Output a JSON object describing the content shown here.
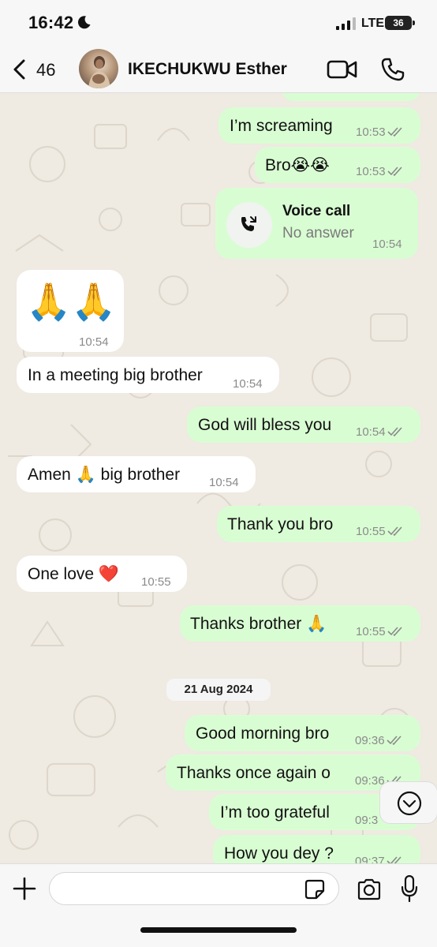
{
  "status_bar": {
    "time": "16:42",
    "network": "LTE",
    "battery": "36"
  },
  "header": {
    "back_count": "46",
    "contact_name": "IKECHUKWU Esther"
  },
  "messages": [
    {
      "dir": "out",
      "text": "I’m screaming",
      "time": "10:53"
    },
    {
      "dir": "out",
      "text": "Bro😭😭",
      "time": "10:53"
    },
    {
      "dir": "out",
      "type": "call",
      "title": "Voice call",
      "subtitle": "No answer",
      "time": "10:54"
    },
    {
      "dir": "in",
      "text": "🙏🙏",
      "time": "10:54"
    },
    {
      "dir": "in",
      "text": "In a meeting big brother",
      "time": "10:54"
    },
    {
      "dir": "out",
      "text": "God will bless you",
      "time": "10:54"
    },
    {
      "dir": "in",
      "text": "Amen 🙏 big brother",
      "time": "10:54"
    },
    {
      "dir": "out",
      "text": "Thank you bro",
      "time": "10:55"
    },
    {
      "dir": "in",
      "text": "One love ❤️",
      "time": "10:55"
    },
    {
      "dir": "out",
      "text": "Thanks brother 🙏",
      "time": "10:55"
    },
    {
      "dir": "out",
      "text": "Good morning bro",
      "time": "09:36"
    },
    {
      "dir": "out",
      "text": "Thanks once again o",
      "time": "09:36"
    },
    {
      "dir": "out",
      "text": "I’m too grateful",
      "time": "09:3"
    },
    {
      "dir": "out",
      "text": "How you dey ?",
      "time": "09:37"
    }
  ],
  "date_separator": "21 Aug 2024",
  "input": {
    "placeholder": ""
  },
  "colors": {
    "outgoing": "#d9fdd3",
    "incoming": "#ffffff",
    "read_ticks": "#8a8a8a",
    "background": "#efeae2"
  },
  "icons": [
    "moon-icon",
    "signal-icon",
    "back-chevron-icon",
    "video-icon",
    "phone-icon",
    "missed-call-icon",
    "chevron-down-icon",
    "plus-icon",
    "sticker-icon",
    "camera-icon",
    "mic-icon"
  ]
}
